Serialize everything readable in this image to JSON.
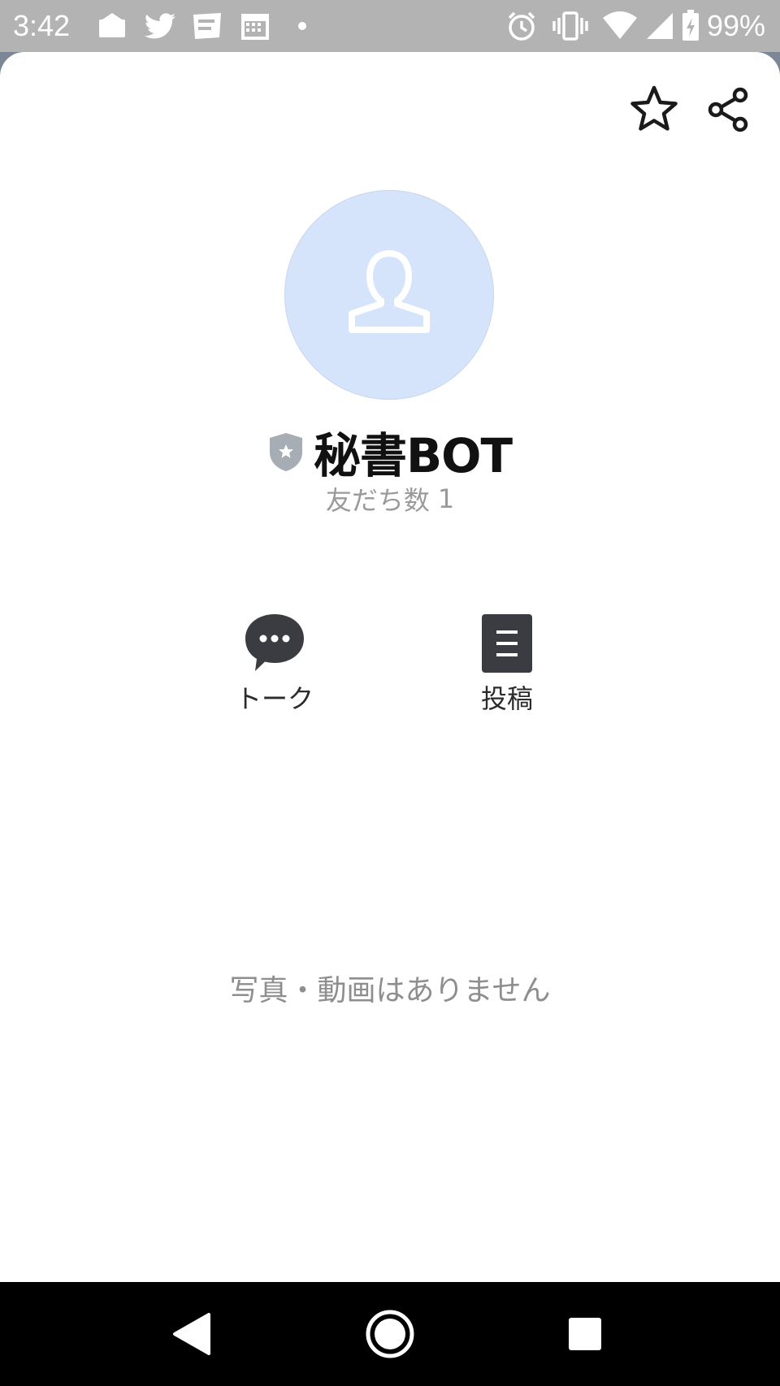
{
  "status_bar": {
    "time": "3:42",
    "battery_text": "99%",
    "left_icons": [
      "mail-icon",
      "twitter-icon",
      "line-manga-icon",
      "calendar-icon",
      "dot-icon"
    ],
    "right_icons": [
      "alarm-icon",
      "vibrate-icon",
      "wifi-icon",
      "signal-icon",
      "battery-charging-icon"
    ]
  },
  "header": {
    "favorite_icon": "star-outline-icon",
    "share_icon": "share-icon"
  },
  "profile": {
    "name": "秘書BOT",
    "friends_label": "友だち数",
    "friends_count": "1",
    "avatar_color": "#d6e4fb"
  },
  "actions": [
    {
      "label": "トーク",
      "icon": "chat-bubble-icon"
    },
    {
      "label": "投稿",
      "icon": "post-icon"
    }
  ],
  "media": {
    "empty_message": "写真・動画はありません"
  },
  "nav_bar": {
    "buttons": [
      "back-icon",
      "home-icon",
      "recents-icon"
    ]
  }
}
